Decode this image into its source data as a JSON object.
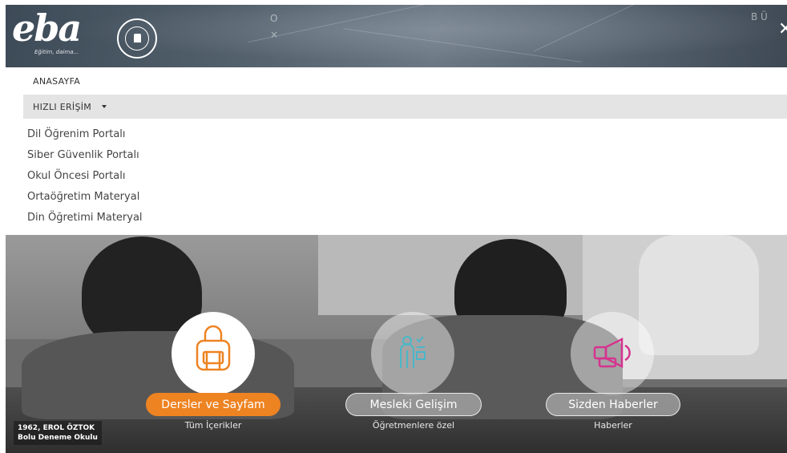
{
  "header": {
    "logo_text": "eba",
    "logo_tagline": "Eğitim, daima...",
    "map_text_top": "B Ü",
    "close_icon": "close-icon"
  },
  "menu": {
    "home_label": "ANASAYFA",
    "quick_access_label": "HIZLI ERİŞİM",
    "submenu": [
      "Dil Öğrenim Portalı",
      "Siber Güvenlik Portalı",
      "Okul Öncesi Portalı",
      "Ortaöğretim Materyal",
      "Din Öğretimi Materyal"
    ]
  },
  "hero": {
    "cards": [
      {
        "icon": "backpack-icon",
        "label": "Dersler ve Sayfam",
        "sublabel": "Tüm İçerikler"
      },
      {
        "icon": "teacher-checklist-icon",
        "label": "Mesleki Gelişim",
        "sublabel": "Öğretmenlere özel"
      },
      {
        "icon": "megaphone-icon",
        "label": "Sizden Haberler",
        "sublabel": "Haberler"
      }
    ],
    "photo_caption_line1": "1962, EROL ÖZTOK",
    "photo_caption_line2": "Bolu Deneme Okulu"
  },
  "colors": {
    "accent_orange": "#ee8322",
    "icon_teal": "#4ab6c9",
    "icon_magenta": "#d6338f"
  }
}
